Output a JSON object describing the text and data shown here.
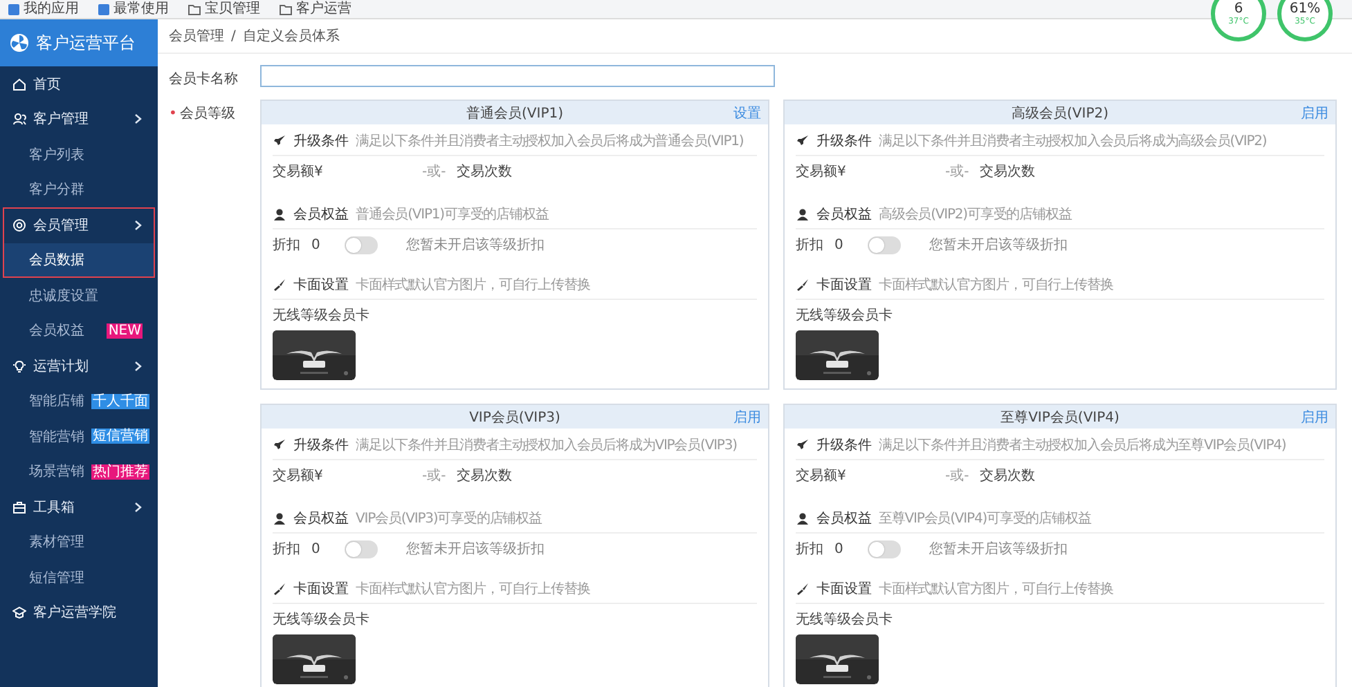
{
  "bookmarks": [
    {
      "label": "我的应用",
      "kind": "app"
    },
    {
      "label": "最常使用",
      "kind": "app"
    },
    {
      "label": "宝贝管理",
      "kind": "folder"
    },
    {
      "label": "客户运营",
      "kind": "folder"
    }
  ],
  "gauges": [
    {
      "value": "6",
      "temp": "37°C"
    },
    {
      "value": "61%",
      "temp": "35°C"
    }
  ],
  "brand": {
    "title": "客户运营平台"
  },
  "sidebar": {
    "items": [
      {
        "label": "首页",
        "kind": "main",
        "arrow": false,
        "selected": false,
        "outlined": false
      },
      {
        "label": "客户管理",
        "kind": "main",
        "arrow": true,
        "selected": false,
        "outlined": false
      },
      {
        "label": "客户列表",
        "kind": "sub",
        "selected": false,
        "outlined": false
      },
      {
        "label": "客户分群",
        "kind": "sub",
        "selected": false,
        "outlined": false
      },
      {
        "label": "会员管理",
        "kind": "main",
        "arrow": true,
        "selected": false,
        "outlined": true
      },
      {
        "label": "会员数据",
        "kind": "sub",
        "selected": true,
        "outlined": true
      },
      {
        "label": "忠诚度设置",
        "kind": "sub",
        "selected": false,
        "outlined": false
      },
      {
        "label": "会员权益",
        "kind": "sub",
        "selected": false,
        "outlined": false,
        "badge": {
          "text": "NEW",
          "color": "#e8177c"
        }
      },
      {
        "label": "运营计划",
        "kind": "main",
        "arrow": true,
        "selected": false,
        "outlined": false
      },
      {
        "label": "智能店铺",
        "kind": "sub",
        "selected": false,
        "outlined": false,
        "badge": {
          "text": "千人千面",
          "color": "#2f8ee5"
        }
      },
      {
        "label": "智能营销",
        "kind": "sub",
        "selected": false,
        "outlined": false,
        "badge": {
          "text": "短信营销",
          "color": "#2f8ee5"
        }
      },
      {
        "label": "场景营销",
        "kind": "sub",
        "selected": false,
        "outlined": false,
        "badge": {
          "text": "热门推荐",
          "color": "#e8177c"
        }
      },
      {
        "label": "工具箱",
        "kind": "main",
        "arrow": true,
        "selected": false,
        "outlined": false
      },
      {
        "label": "素材管理",
        "kind": "sub",
        "selected": false,
        "outlined": false
      },
      {
        "label": "短信管理",
        "kind": "sub",
        "selected": false,
        "outlined": false
      },
      {
        "label": "客户运营学院",
        "kind": "main",
        "arrow": false,
        "selected": false,
        "outlined": false
      }
    ]
  },
  "breadcrumb": [
    "会员管理",
    "/",
    "自定义会员体系"
  ],
  "form": {
    "name_label": "会员卡名称",
    "level_label": "会员等级",
    "required_mark": "•"
  },
  "cards": [
    {
      "title": "普通会员(VIP1)",
      "action": "设置",
      "upgrade": {
        "label": "升级条件",
        "desc": "满足以下条件并且消费者主动授权加入会员后将成为普通会员(VIP1)"
      },
      "trade": {
        "amount_label": "交易额¥",
        "or": "-或-",
        "count_label": "交易次数"
      },
      "benefit": {
        "label": "会员权益",
        "desc": "普通会员(VIP1)可享受的店铺权益"
      },
      "discount": {
        "label": "折扣",
        "value": "0",
        "on": false,
        "hint": "您暂未开启该等级折扣"
      },
      "design": {
        "label": "卡面设置",
        "desc": "卡面样式默认官方图片，可自行上传替换"
      },
      "card_name": "无线等级会员卡"
    },
    {
      "title": "高级会员(VIP2)",
      "action": "启用",
      "upgrade": {
        "label": "升级条件",
        "desc": "满足以下条件并且消费者主动授权加入会员后将成为高级会员(VIP2)"
      },
      "trade": {
        "amount_label": "交易额¥",
        "or": "-或-",
        "count_label": "交易次数"
      },
      "benefit": {
        "label": "会员权益",
        "desc": "高级会员(VIP2)可享受的店铺权益"
      },
      "discount": {
        "label": "折扣",
        "value": "0",
        "on": false,
        "hint": "您暂未开启该等级折扣"
      },
      "design": {
        "label": "卡面设置",
        "desc": "卡面样式默认官方图片，可自行上传替换"
      },
      "card_name": "无线等级会员卡"
    },
    {
      "title": "VIP会员(VIP3)",
      "action": "启用",
      "upgrade": {
        "label": "升级条件",
        "desc": "满足以下条件并且消费者主动授权加入会员后将成为VIP会员(VIP3)"
      },
      "trade": {
        "amount_label": "交易额¥",
        "or": "-或-",
        "count_label": "交易次数"
      },
      "benefit": {
        "label": "会员权益",
        "desc": "VIP会员(VIP3)可享受的店铺权益"
      },
      "discount": {
        "label": "折扣",
        "value": "0",
        "on": false,
        "hint": "您暂未开启该等级折扣"
      },
      "design": {
        "label": "卡面设置",
        "desc": "卡面样式默认官方图片，可自行上传替换"
      },
      "card_name": "无线等级会员卡"
    },
    {
      "title": "至尊VIP会员(VIP4)",
      "action": "启用",
      "upgrade": {
        "label": "升级条件",
        "desc": "满足以下条件并且消费者主动授权加入会员后将成为至尊VIP会员(VIP4)"
      },
      "trade": {
        "amount_label": "交易额¥",
        "or": "-或-",
        "count_label": "交易次数"
      },
      "benefit": {
        "label": "会员权益",
        "desc": "至尊VIP会员(VIP4)可享受的店铺权益"
      },
      "discount": {
        "label": "折扣",
        "value": "0",
        "on": false,
        "hint": "您暂未开启该等级折扣"
      },
      "design": {
        "label": "卡面设置",
        "desc": "卡面样式默认官方图片，可自行上传替换"
      },
      "card_name": "无线等级会员卡"
    }
  ]
}
